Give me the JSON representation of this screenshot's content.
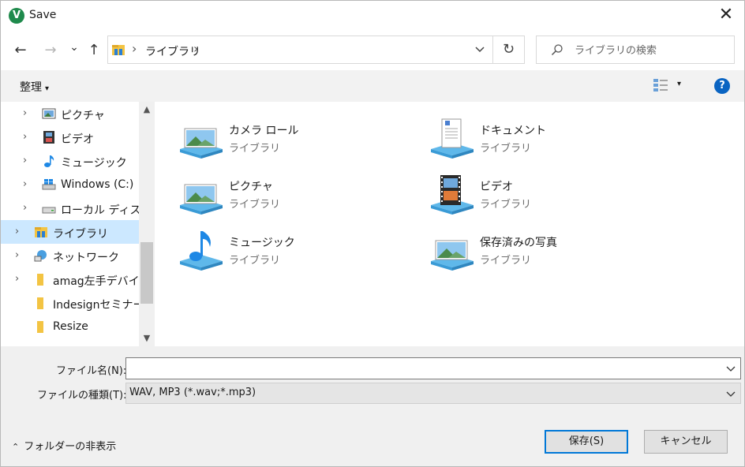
{
  "window": {
    "title": "Save",
    "app_icon_letter": "V",
    "close_glyph": "✕"
  },
  "nav": {
    "back_glyph": "←",
    "forward_glyph": "→",
    "recent_glyph": "⌄",
    "up_glyph": "↑",
    "breadcrumb": "ライブラリ",
    "crumb_sep": "›",
    "refresh_glyph": "↻",
    "search_placeholder": "ライブラリの検索"
  },
  "command_bar": {
    "organize_label": "整理",
    "organize_caret": "▾",
    "view_caret": "▾",
    "help_glyph": "?"
  },
  "sidebar": {
    "chevron": "›",
    "items": [
      {
        "label": "ピクチャ",
        "icon": "pictures-icon"
      },
      {
        "label": "ビデオ",
        "icon": "videos-icon"
      },
      {
        "label": "ミュージック",
        "icon": "music-icon"
      },
      {
        "label": "Windows (C:)",
        "icon": "windows-drive-icon"
      },
      {
        "label": "ローカル ディスク (",
        "icon": "local-disk-icon"
      },
      {
        "label": "ライブラリ",
        "icon": "libraries-icon",
        "selected": true
      },
      {
        "label": "ネットワーク",
        "icon": "network-icon"
      },
      {
        "label": "amag左手デバイス",
        "icon": "folder-icon"
      },
      {
        "label": "Indesignセミナー",
        "icon": "folder-icon"
      },
      {
        "label": "Resize",
        "icon": "folder-icon"
      }
    ],
    "scroll_up_glyph": "▲",
    "scroll_down_glyph": "▼"
  },
  "libraries": [
    {
      "name": "カメラ ロール",
      "type": "ライブラリ",
      "icon": "camera-roll-library-icon"
    },
    {
      "name": "ドキュメント",
      "type": "ライブラリ",
      "icon": "documents-library-icon"
    },
    {
      "name": "ピクチャ",
      "type": "ライブラリ",
      "icon": "pictures-library-icon"
    },
    {
      "name": "ビデオ",
      "type": "ライブラリ",
      "icon": "videos-library-icon"
    },
    {
      "name": "ミュージック",
      "type": "ライブラリ",
      "icon": "music-library-icon"
    },
    {
      "name": "保存済みの写真",
      "type": "ライブラリ",
      "icon": "saved-pictures-library-icon"
    }
  ],
  "form": {
    "filename_label": "ファイル名(N):",
    "filename_value": "",
    "filetype_label": "ファイルの種類(T):",
    "filetype_value": "WAV, MP3 (*.wav;*.mp3)"
  },
  "footer": {
    "hide_folders_caret": "⌃",
    "hide_folders_label": "フォルダーの非表示",
    "save_label": "保存(S)",
    "cancel_label": "キャンセル"
  }
}
